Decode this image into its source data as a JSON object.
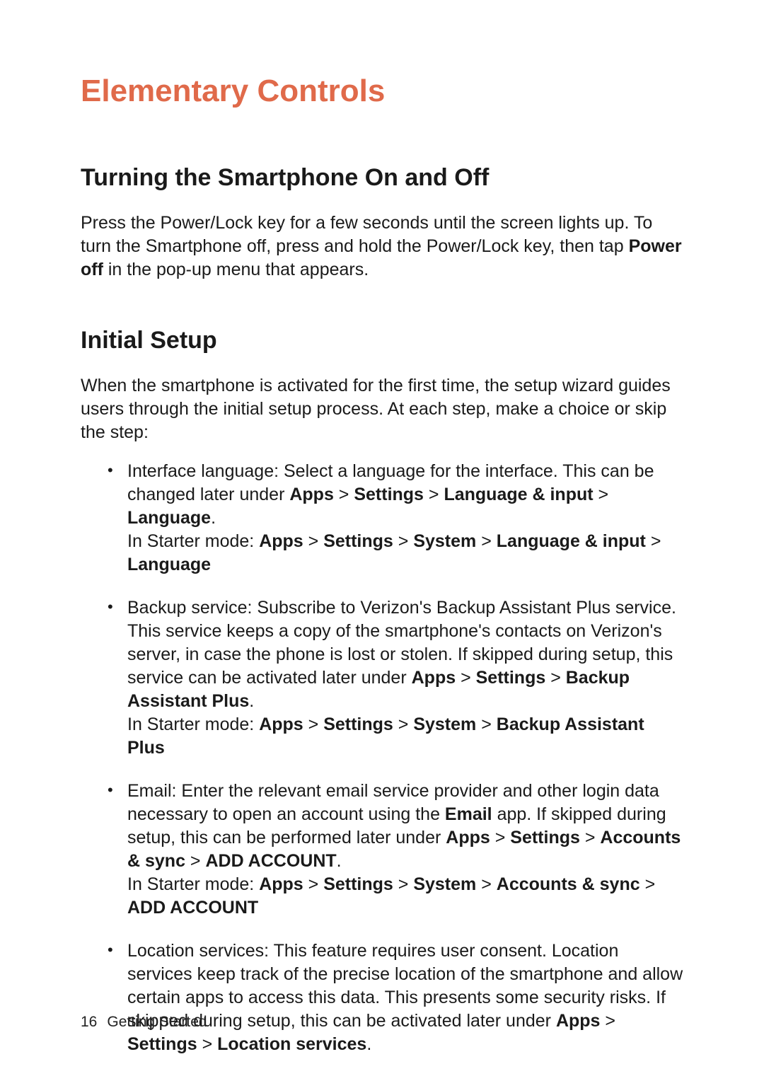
{
  "chapter_title": "Elementary Controls",
  "section1": {
    "heading": "Turning the Smartphone On and Off",
    "para_pre": "Press the Power/Lock key for a few seconds until the screen lights up. To turn the Smartphone off, press and hold the Power/Lock key, then tap ",
    "para_bold": "Power off",
    "para_post": " in the pop-up menu that appears."
  },
  "section2": {
    "heading": "Initial Setup",
    "intro": "When the smartphone is activated for the first time, the setup wizard guides users through the initial setup process. At each step, make a choice or skip the step:",
    "items": [
      {
        "lead": "Interface language: Select a language for the interface. This can be changed later under ",
        "path1": [
          "Apps",
          "Settings",
          "Language & input",
          "Language"
        ],
        "tail1": ".",
        "starter_prefix": "In Starter mode: ",
        "path2": [
          "Apps",
          "Settings",
          "System",
          "Language & input",
          "Language"
        ],
        "tail2": ""
      },
      {
        "lead": "Backup service: Subscribe to Verizon's Backup Assistant Plus service. This service keeps a copy of the smartphone's contacts on Verizon's server, in case the phone is lost or stolen. If skipped during setup, this service can be activated later under ",
        "path1": [
          "Apps",
          "Settings",
          "Backup Assistant Plus"
        ],
        "tail1": ".",
        "starter_prefix": "In Starter mode: ",
        "path2": [
          "Apps",
          "Settings",
          "System",
          "Backup Assistant Plus"
        ],
        "tail2": ""
      },
      {
        "lead": "Email: Enter the relevant email service provider and other login data necessary to open an account using the ",
        "mid_bold": "Email",
        "mid_text": " app. If skipped during setup, this can be performed later under ",
        "path1": [
          "Apps",
          "Settings",
          "Accounts & sync",
          "ADD ACCOUNT"
        ],
        "tail1": ".",
        "starter_prefix": "In Starter mode: ",
        "path2": [
          "Apps",
          "Settings",
          "System",
          "Accounts & sync",
          "ADD ACCOUNT"
        ],
        "tail2": ""
      },
      {
        "lead": "Location services: This feature requires user consent. Location services keep track of the precise location of the smartphone and allow certain apps to access this data. This presents some security risks. If skipped during setup, this can be activated later under ",
        "path1": [
          "Apps",
          "Settings",
          "Location services"
        ],
        "tail1": "."
      }
    ]
  },
  "gt": " > ",
  "footer": {
    "page": "16",
    "section": "Getting Started"
  }
}
